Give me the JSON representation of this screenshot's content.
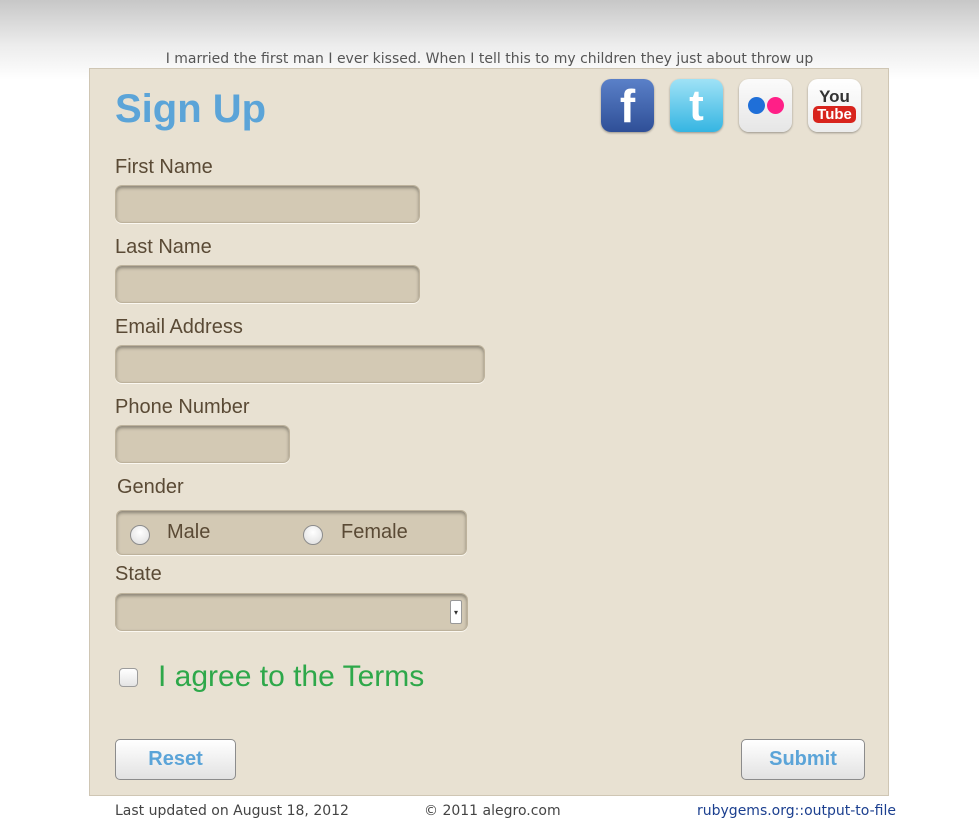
{
  "quote": "I married the first man I ever kissed. When I tell this to my children they just about throw up",
  "form": {
    "title": "Sign Up",
    "first_name": {
      "label": "First Name",
      "value": ""
    },
    "last_name": {
      "label": "Last Name",
      "value": ""
    },
    "email": {
      "label": "Email Address",
      "value": ""
    },
    "phone": {
      "label": "Phone Number",
      "value": ""
    },
    "gender": {
      "label": "Gender",
      "options": [
        "Male",
        "Female"
      ]
    },
    "state": {
      "label": "State",
      "value": ""
    },
    "terms_label": "I agree to the Terms",
    "reset_label": "Reset",
    "submit_label": "Submit"
  },
  "social": {
    "icons": [
      "facebook-icon",
      "twitter-icon",
      "flickr-icon",
      "youtube-icon"
    ],
    "facebook_glyph": "f",
    "twitter_glyph": "t",
    "youtube_you": "You",
    "youtube_tube": "Tube"
  },
  "footer": {
    "updated": "Last updated on August 18, 2012",
    "copyright": "© 2011 alegro.com",
    "link": "rubygems.org::output-to-file"
  },
  "colors": {
    "accent": "#5ba4d8",
    "terms": "#2ea84a",
    "card": "#e8e1d2",
    "field": "#d3c9b4"
  }
}
